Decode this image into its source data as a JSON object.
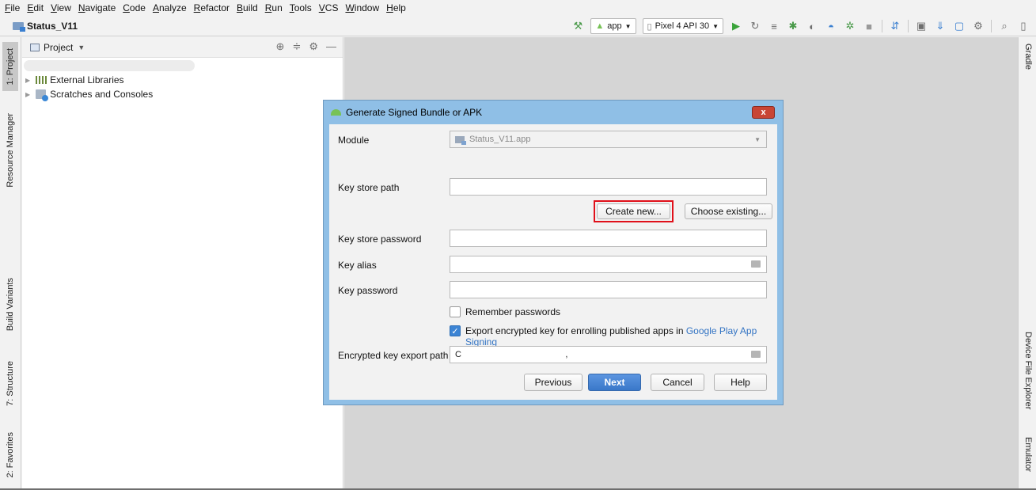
{
  "menu": [
    "File",
    "Edit",
    "View",
    "Navigate",
    "Code",
    "Analyze",
    "Refactor",
    "Build",
    "Run",
    "Tools",
    "VCS",
    "Window",
    "Help"
  ],
  "breadcrumb": "Status_V11",
  "toolbar": {
    "run_config": "app",
    "device": "Pixel 4 API 30",
    "icons": [
      "hammer-icon",
      "run-icon",
      "apply-changes-icon",
      "debug-icon",
      "profile-icon",
      "attach-debugger-icon",
      "stop-icon",
      "sync-icon",
      "avd-manager-icon",
      "sdk-manager-icon",
      "search-icon"
    ]
  },
  "left_tabs": [
    "1: Project",
    "Resource Manager",
    "Build Variants",
    "7: Structure",
    "2: Favorites"
  ],
  "right_tabs": [
    "Gradle",
    "Device File Explorer",
    "Emulator"
  ],
  "project_panel": {
    "title": "Project",
    "tree": [
      "External Libraries",
      "Scratches and Consoles"
    ]
  },
  "dialog": {
    "title": "Generate Signed Bundle or APK",
    "close_label": "x",
    "module_label": "Module",
    "module_value": "Status_V11.app",
    "key_store_path_label": "Key store path",
    "key_store_path_value": "",
    "create_new": "Create new...",
    "choose_existing": "Choose existing...",
    "key_store_password_label": "Key store password",
    "key_alias_label": "Key alias",
    "key_password_label": "Key password",
    "remember_passwords": "Remember passwords",
    "remember_checked": false,
    "export_text": "Export encrypted key for enrolling published apps in",
    "export_link": "Google Play App Signing",
    "export_checked": true,
    "export_path_label": "Encrypted key export path",
    "export_path_value": "C                                           ,",
    "buttons": {
      "previous": "Previous",
      "next": "Next",
      "cancel": "Cancel",
      "help": "Help"
    }
  }
}
